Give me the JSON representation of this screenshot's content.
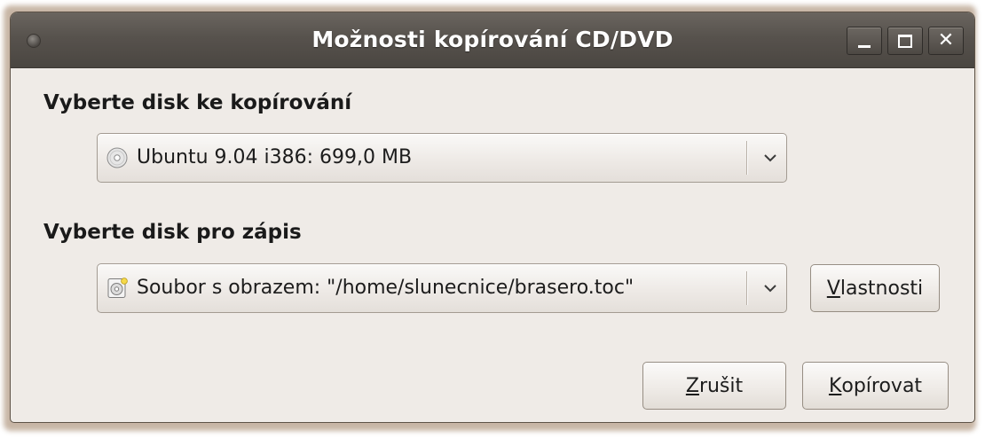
{
  "window": {
    "title": "Možnosti kopírování CD/DVD"
  },
  "source": {
    "heading": "Vyberte disk ke kopírování",
    "selected": "Ubuntu 9.04 i386: 699,0 MB",
    "icon": "cd-disc-icon"
  },
  "destination": {
    "heading": "Vyberte disk pro zápis",
    "selected": "Soubor s obrazem: \"/home/slunecnice/brasero.toc\"",
    "icon": "image-file-icon",
    "properties_mnemonic": "V",
    "properties_rest": "lastnosti"
  },
  "actions": {
    "cancel_mnemonic": "Z",
    "cancel_rest": "rušit",
    "copy_mnemonic": "K",
    "copy_rest": "opírovat"
  }
}
